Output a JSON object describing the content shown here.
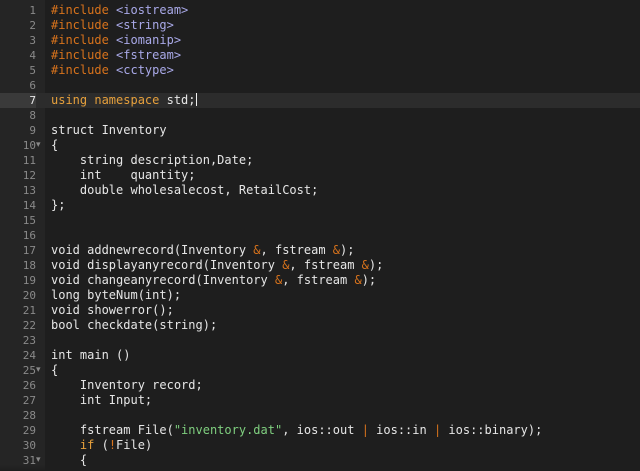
{
  "editor": {
    "language": "cpp",
    "cursor_line": 7,
    "colors": {
      "background": "#1e1e1e",
      "gutter": "#252525",
      "directive": "#d8731c",
      "include_path": "#a9a9e8",
      "keyword": "#e6a03c",
      "string": "#7fcf7f",
      "text": "#e6e6e6",
      "line_number": "#8a8a8a"
    },
    "lines": [
      {
        "n": "1",
        "fold": false,
        "tokens": [
          {
            "t": "#include ",
            "c": "dir"
          },
          {
            "t": "<iostream>",
            "c": "inc"
          }
        ]
      },
      {
        "n": "2",
        "fold": false,
        "tokens": [
          {
            "t": "#include ",
            "c": "dir"
          },
          {
            "t": "<string>",
            "c": "inc"
          }
        ]
      },
      {
        "n": "3",
        "fold": false,
        "tokens": [
          {
            "t": "#include ",
            "c": "dir"
          },
          {
            "t": "<iomanip>",
            "c": "inc"
          }
        ]
      },
      {
        "n": "4",
        "fold": false,
        "tokens": [
          {
            "t": "#include ",
            "c": "dir"
          },
          {
            "t": "<fstream>",
            "c": "inc"
          }
        ]
      },
      {
        "n": "5",
        "fold": false,
        "tokens": [
          {
            "t": "#include ",
            "c": "dir"
          },
          {
            "t": "<cctype>",
            "c": "inc"
          }
        ]
      },
      {
        "n": "6",
        "fold": false,
        "tokens": []
      },
      {
        "n": "7",
        "fold": false,
        "active": true,
        "tokens": [
          {
            "t": "using ",
            "c": "kw"
          },
          {
            "t": "namespace ",
            "c": "kw"
          },
          {
            "t": "std;",
            "c": "pl"
          }
        ]
      },
      {
        "n": "8",
        "fold": false,
        "tokens": []
      },
      {
        "n": "9",
        "fold": false,
        "tokens": [
          {
            "t": "struct Inventory",
            "c": "pl"
          }
        ]
      },
      {
        "n": "10",
        "fold": true,
        "tokens": [
          {
            "t": "{",
            "c": "pl"
          }
        ]
      },
      {
        "n": "11",
        "fold": false,
        "tokens": [
          {
            "t": "    string description,Date;",
            "c": "pl"
          }
        ]
      },
      {
        "n": "12",
        "fold": false,
        "tokens": [
          {
            "t": "    int    quantity;",
            "c": "pl"
          }
        ]
      },
      {
        "n": "13",
        "fold": false,
        "tokens": [
          {
            "t": "    double wholesalecost, RetailCost;",
            "c": "pl"
          }
        ]
      },
      {
        "n": "14",
        "fold": false,
        "tokens": [
          {
            "t": "};",
            "c": "pl"
          }
        ]
      },
      {
        "n": "15",
        "fold": false,
        "tokens": []
      },
      {
        "n": "16",
        "fold": false,
        "tokens": []
      },
      {
        "n": "17",
        "fold": false,
        "tokens": [
          {
            "t": "void addnewrecord(Inventory ",
            "c": "pl"
          },
          {
            "t": "&",
            "c": "op"
          },
          {
            "t": ", fstream ",
            "c": "pl"
          },
          {
            "t": "&",
            "c": "op"
          },
          {
            "t": ");",
            "c": "pl"
          }
        ]
      },
      {
        "n": "18",
        "fold": false,
        "tokens": [
          {
            "t": "void displayanyrecord(Inventory ",
            "c": "pl"
          },
          {
            "t": "&",
            "c": "op"
          },
          {
            "t": ", fstream ",
            "c": "pl"
          },
          {
            "t": "&",
            "c": "op"
          },
          {
            "t": ");",
            "c": "pl"
          }
        ]
      },
      {
        "n": "19",
        "fold": false,
        "tokens": [
          {
            "t": "void changeanyrecord(Inventory ",
            "c": "pl"
          },
          {
            "t": "&",
            "c": "op"
          },
          {
            "t": ", fstream ",
            "c": "pl"
          },
          {
            "t": "&",
            "c": "op"
          },
          {
            "t": ");",
            "c": "pl"
          }
        ]
      },
      {
        "n": "20",
        "fold": false,
        "tokens": [
          {
            "t": "long byteNum(int);",
            "c": "pl"
          }
        ]
      },
      {
        "n": "21",
        "fold": false,
        "tokens": [
          {
            "t": "void showerror();",
            "c": "pl"
          }
        ]
      },
      {
        "n": "22",
        "fold": false,
        "tokens": [
          {
            "t": "bool checkdate(string);",
            "c": "pl"
          }
        ]
      },
      {
        "n": "23",
        "fold": false,
        "tokens": []
      },
      {
        "n": "24",
        "fold": false,
        "tokens": [
          {
            "t": "int main ()",
            "c": "pl"
          }
        ]
      },
      {
        "n": "25",
        "fold": true,
        "tokens": [
          {
            "t": "{",
            "c": "pl"
          }
        ]
      },
      {
        "n": "26",
        "fold": false,
        "tokens": [
          {
            "t": "    Inventory record;",
            "c": "pl"
          }
        ]
      },
      {
        "n": "27",
        "fold": false,
        "tokens": [
          {
            "t": "    int Input;",
            "c": "pl"
          }
        ]
      },
      {
        "n": "28",
        "fold": false,
        "tokens": []
      },
      {
        "n": "29",
        "fold": false,
        "tokens": [
          {
            "t": "    fstream File(",
            "c": "pl"
          },
          {
            "t": "\"inventory.dat\"",
            "c": "str"
          },
          {
            "t": ", ios::out ",
            "c": "pl"
          },
          {
            "t": "|",
            "c": "op"
          },
          {
            "t": " ios::in ",
            "c": "pl"
          },
          {
            "t": "|",
            "c": "op"
          },
          {
            "t": " ios::binary);",
            "c": "pl"
          }
        ]
      },
      {
        "n": "30",
        "fold": false,
        "tokens": [
          {
            "t": "    ",
            "c": "pl"
          },
          {
            "t": "if",
            "c": "kw"
          },
          {
            "t": " (",
            "c": "pl"
          },
          {
            "t": "!",
            "c": "op"
          },
          {
            "t": "File)",
            "c": "pl"
          }
        ]
      },
      {
        "n": "31",
        "fold": true,
        "tokens": [
          {
            "t": "    {",
            "c": "pl"
          }
        ]
      }
    ]
  }
}
